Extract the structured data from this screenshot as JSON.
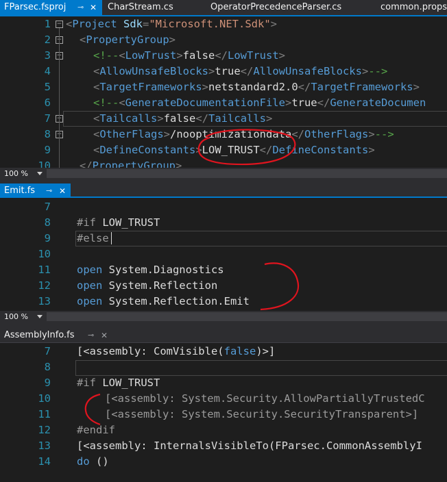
{
  "top_tabs": [
    {
      "label": "FParsec.fsproj",
      "active": true
    },
    {
      "label": "CharStream.cs",
      "active": false
    },
    {
      "label": "OperatorPrecedenceParser.cs",
      "active": false
    },
    {
      "label": "common.props",
      "active": false
    }
  ],
  "pane1": {
    "zoom": "100 %",
    "lines": [
      {
        "n": "1",
        "segs": [
          [
            "<",
            "punc"
          ],
          [
            "Project",
            "tag"
          ],
          [
            " Sdk",
            "attr"
          ],
          [
            "=",
            "punc"
          ],
          [
            "\"Microsoft.NET.Sdk\"",
            "str"
          ],
          [
            ">",
            "punc"
          ]
        ]
      },
      {
        "n": "2",
        "segs": [
          [
            "<",
            "punc"
          ],
          [
            "PropertyGroup",
            "tag"
          ],
          [
            ">",
            "punc"
          ]
        ]
      },
      {
        "n": "3",
        "segs": [
          [
            "<!--",
            "cmt"
          ],
          [
            "<",
            "punc"
          ],
          [
            "LowTrust",
            "tag"
          ],
          [
            ">",
            "punc"
          ],
          [
            "false",
            "txt"
          ],
          [
            "</",
            "punc"
          ],
          [
            "LowTrust",
            "tag"
          ],
          [
            ">",
            "punc"
          ]
        ]
      },
      {
        "n": "4",
        "segs": [
          [
            "<",
            "punc"
          ],
          [
            "AllowUnsafeBlocks",
            "tag"
          ],
          [
            ">",
            "punc"
          ],
          [
            "true",
            "txt"
          ],
          [
            "</",
            "punc"
          ],
          [
            "AllowUnsafeBlocks",
            "tag"
          ],
          [
            ">",
            "punc"
          ],
          [
            "-->",
            "cmt"
          ]
        ]
      },
      {
        "n": "5",
        "segs": [
          [
            "<",
            "punc"
          ],
          [
            "TargetFrameworks",
            "tag"
          ],
          [
            ">",
            "punc"
          ],
          [
            "netstandard2.0",
            "txt"
          ],
          [
            "</",
            "punc"
          ],
          [
            "TargetFrameworks",
            "tag"
          ],
          [
            ">",
            "punc"
          ]
        ]
      },
      {
        "n": "6",
        "segs": [
          [
            "<!--",
            "cmt"
          ],
          [
            "<",
            "punc"
          ],
          [
            "GenerateDocumentationFile",
            "tag"
          ],
          [
            ">",
            "punc"
          ],
          [
            "true",
            "txt"
          ],
          [
            "</",
            "punc"
          ],
          [
            "GenerateDocumen",
            "tag"
          ]
        ]
      },
      {
        "n": "7",
        "segs": [
          [
            "<",
            "punc"
          ],
          [
            "Tailcalls",
            "tag"
          ],
          [
            ">",
            "punc"
          ],
          [
            "false",
            "txt"
          ],
          [
            "</",
            "punc"
          ],
          [
            "Tailcalls",
            "tag"
          ],
          [
            ">",
            "punc"
          ]
        ]
      },
      {
        "n": "8",
        "segs": [
          [
            "<",
            "punc"
          ],
          [
            "OtherFlags",
            "tag"
          ],
          [
            ">",
            "punc"
          ],
          [
            "/nooptimizationdata",
            "txt"
          ],
          [
            "</",
            "punc"
          ],
          [
            "OtherFlags",
            "tag"
          ],
          [
            ">",
            "punc"
          ],
          [
            "-->",
            "cmt"
          ]
        ]
      },
      {
        "n": "9",
        "segs": [
          [
            "<",
            "punc"
          ],
          [
            "DefineConstants",
            "tag"
          ],
          [
            ">",
            "punc"
          ],
          [
            "LOW_TRUST",
            "txt"
          ],
          [
            "</",
            "punc"
          ],
          [
            "DefineConstants",
            "tag"
          ],
          [
            ">",
            "punc"
          ]
        ]
      },
      {
        "n": "10",
        "segs": [
          [
            "</",
            "punc"
          ],
          [
            "PropertyGroup",
            "tag"
          ],
          [
            ">",
            "punc"
          ]
        ]
      }
    ]
  },
  "pane2": {
    "tab": "Emit.fs",
    "zoom": "100 %",
    "lines": [
      {
        "n": "7",
        "segs": []
      },
      {
        "n": "8",
        "segs": [
          [
            "#if",
            "dir"
          ],
          [
            " LOW_TRUST",
            "id"
          ]
        ]
      },
      {
        "n": "9",
        "segs": [
          [
            "#else",
            "dir"
          ]
        ]
      },
      {
        "n": "10",
        "segs": []
      },
      {
        "n": "11",
        "segs": [
          [
            "open",
            "kw"
          ],
          [
            " System.Diagnostics",
            "id"
          ]
        ]
      },
      {
        "n": "12",
        "segs": [
          [
            "open",
            "kw"
          ],
          [
            " System.Reflection",
            "id"
          ]
        ]
      },
      {
        "n": "13",
        "segs": [
          [
            "open",
            "kw"
          ],
          [
            " System.Reflection.Emit",
            "id"
          ]
        ]
      }
    ]
  },
  "pane3": {
    "tab": "AssemblyInfo.fs",
    "lines": [
      {
        "n": "7",
        "segs": [
          [
            "[<assembly: ComVisible(",
            "id"
          ],
          [
            "false",
            "kw"
          ],
          [
            ")>]",
            "id"
          ]
        ]
      },
      {
        "n": "8",
        "segs": []
      },
      {
        "n": "9",
        "segs": [
          [
            "#if",
            "dir"
          ],
          [
            " LOW_TRUST",
            "id"
          ]
        ]
      },
      {
        "n": "10",
        "segs": [
          [
            "[<assembly: System.Security.AllowPartiallyTrustedC",
            "gray"
          ]
        ]
      },
      {
        "n": "11",
        "segs": [
          [
            "[<assembly: System.Security.SecurityTransparent>]",
            "gray"
          ]
        ]
      },
      {
        "n": "12",
        "segs": [
          [
            "#endif",
            "dir"
          ]
        ]
      },
      {
        "n": "13",
        "segs": [
          [
            "[<assembly: InternalsVisibleTo(FParsec.CommonAssemblyI",
            "id"
          ]
        ]
      },
      {
        "n": "14",
        "segs": [
          [
            "do ()",
            "mixdo"
          ]
        ]
      }
    ]
  },
  "icons": {
    "pin": "pin-icon",
    "close": "close-icon",
    "dropdown": "chevron-down-icon"
  },
  "colors": {
    "accent": "#007acc",
    "annotation": "#e0141e",
    "line_number": "#2b91af",
    "keyword": "#569cd6"
  }
}
